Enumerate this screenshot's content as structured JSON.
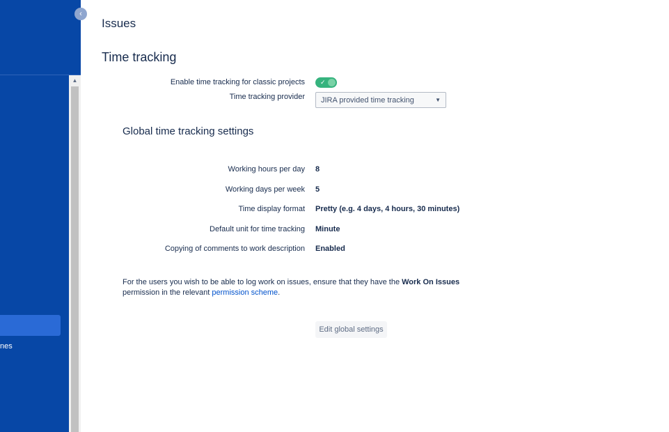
{
  "sidebar": {
    "collapse_icon": "chevron-left-icon",
    "partial_item_label": "nes"
  },
  "page": {
    "title": "Issues",
    "section_title": "Time tracking"
  },
  "time_tracking": {
    "enable_label": "Enable time tracking for classic projects",
    "enable_state": true,
    "toggle_icon": "check",
    "provider_label": "Time tracking provider",
    "provider_value": "JIRA provided time tracking"
  },
  "global_settings": {
    "title": "Global time tracking settings",
    "rows": [
      {
        "label": "Working hours per day",
        "value": "8"
      },
      {
        "label": "Working days per week",
        "value": "5"
      },
      {
        "label": "Time display format",
        "value": "Pretty (e.g. 4 days, 4 hours, 30 minutes)"
      },
      {
        "label": "Default unit for time tracking",
        "value": "Minute"
      },
      {
        "label": "Copying of comments to work description",
        "value": "Enabled"
      }
    ]
  },
  "info": {
    "prefix": "For the users you wish to be able to log work on issues, ensure that they have the ",
    "permission_name": "Work On Issues",
    "middle": " permission in the relevant ",
    "link_text": "permission scheme",
    "suffix": "."
  },
  "actions": {
    "edit_label": "Edit global settings"
  },
  "colors": {
    "sidebar": "#0747a6",
    "sidebar_selected": "#2a6ad6",
    "toggle_on": "#36b37e",
    "link": "#0052cc",
    "text": "#172b4d"
  }
}
